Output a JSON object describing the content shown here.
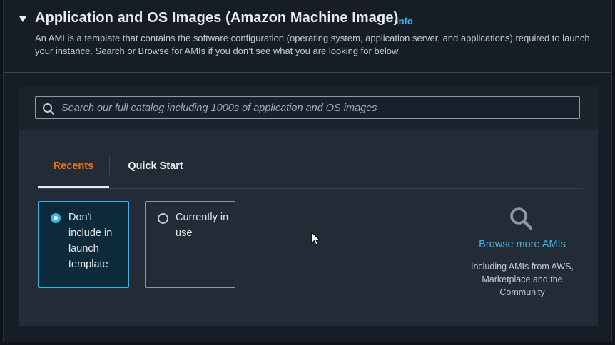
{
  "section": {
    "title": "Application and OS Images (Amazon Machine Image)",
    "info_label": "Info",
    "description": "An AMI is a template that contains the software configuration (operating system, application server, and applications) required to launch your instance. Search or Browse for AMIs if you don’t see what you are looking for below"
  },
  "search": {
    "placeholder": "Search our full catalog including 1000s of application and OS images",
    "value": ""
  },
  "tabs": [
    {
      "label": "Recents",
      "active": true
    },
    {
      "label": "Quick Start",
      "active": false
    }
  ],
  "options": [
    {
      "label": "Don't include in launch template",
      "selected": true
    },
    {
      "label": "Currently in use",
      "selected": false
    }
  ],
  "browse": {
    "link_label": "Browse more AMIs",
    "sub_text": "Including AMIs from AWS, Marketplace and the Community"
  },
  "colors": {
    "accent_blue": "#3ab5e8",
    "active_tab": "#ec7211",
    "background": "#161d26"
  }
}
